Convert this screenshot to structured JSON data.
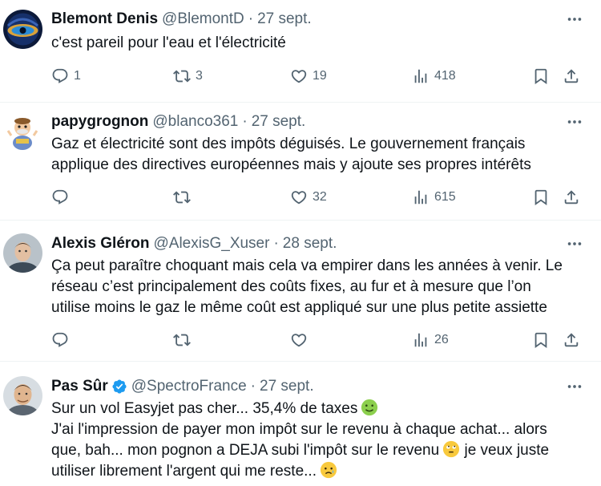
{
  "tweets": [
    {
      "name": "Blemont Denis",
      "handle": "@BlemontD",
      "separator": "·",
      "date": "27 sept.",
      "verified": false,
      "lines": [
        "c'est pareil pour l'eau et l'électricité"
      ],
      "replies": "1",
      "retweets": "3",
      "likes": "19",
      "views": "418"
    },
    {
      "name": "papygrognon",
      "handle": "@blanco361",
      "separator": "·",
      "date": "27 sept.",
      "verified": false,
      "lines": [
        "Gaz et électricité sont des impôts déguisés. Le gouvernement français",
        "applique des directives européennes mais y ajoute ses propres intérêts"
      ],
      "replies": "",
      "retweets": "",
      "likes": "32",
      "views": "615"
    },
    {
      "name": "Alexis Gléron",
      "handle": "@AlexisG_Xuser",
      "separator": "·",
      "date": "28 sept.",
      "verified": false,
      "lines": [
        "Ça peut paraître choquant mais cela va empirer dans les années à venir. Le",
        "réseau c’est principalement des coûts fixes, au fur et à mesure que l’on",
        "utilise moins le gaz le même coût est appliqué sur une plus petite assiette"
      ],
      "replies": "",
      "retweets": "",
      "likes": "",
      "views": "26"
    },
    {
      "name": "Pas Sûr",
      "handle": "@SpectroFrance",
      "separator": "·",
      "date": "27 sept.",
      "verified": true,
      "lines": [
        "Sur un vol Easyjet pas cher... 35,4% de taxes",
        "J'ai l'impression de payer mon impôt sur le revenu à chaque achat... alors",
        "que, bah... mon pognon a DEJA subi l'impôt sur le revenu",
        "utiliser librement l'argent qui me reste..."
      ],
      "line3_suffix": "je veux juste"
    }
  ],
  "icons": {
    "more": "more-horizontal-icon",
    "reply": "reply-icon",
    "retweet": "retweet-icon",
    "like": "heart-icon",
    "views": "views-chart-icon",
    "bookmark": "bookmark-icon",
    "share": "share-icon",
    "verified": "verified-badge-icon",
    "emoji_1": "nauseated-face-emoji",
    "emoji_2": "face-with-rolling-eyes-emoji",
    "emoji_3": "sad-but-relieved-face-emoji"
  },
  "colors": {
    "text": "#0f1419",
    "secondary": "#536471",
    "verified": "#1d9bf0",
    "divider": "#eff3f4"
  }
}
